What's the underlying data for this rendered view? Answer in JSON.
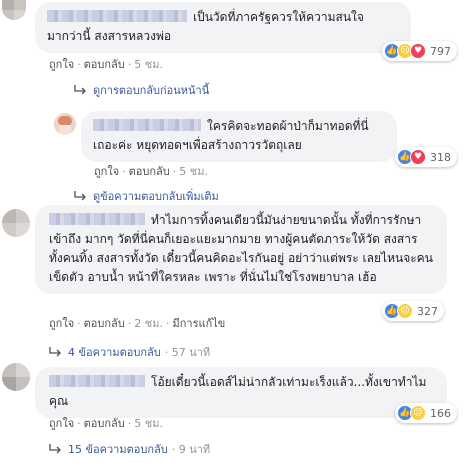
{
  "comments": [
    {
      "text": "เป็นวัดที่ภาครัฐควรให้ความสนใจมากว่านี้ สงสารหลวงพ่อ",
      "like": "ถูกใจ",
      "reply": "ตอบกลับ",
      "time": "5 ชม.",
      "reaction_count": "797"
    },
    {
      "text": "ใครคิดจะทอดผ้าป่าก็มาทอดที่นี่เถอะค่ะ หยุดทอดฯเพื่อสร้างถาวรวัตถุเลย",
      "like": "ถูกใจ",
      "reply": "ตอบกลับ",
      "time": "5 ชม.",
      "reaction_count": "318"
    },
    {
      "text": "ทำไมการทิ้งคนเดียวนี้มันง่ายขนาดนั้น ทั้งที่การรักษา เข้าถึง มากๆ วัดที่นี่คนก็เยอะแยะมากมาย ทางผู้คนตัดภาระให้วัด สงสารทั้งคนทิ้ง สงสารทั้งวัด เดี๋ยวนี้คนคิดอะไรกันอยู่ อย่าว่าแต่พระ เลยไหนจะคนเข็ดตัว อาบน้ำ หน้าที่ใครหละ เพราะ ที่นั่นไม่ใช่โรงพยาบาล เฮ้อ",
      "like": "ถูกใจ",
      "reply": "ตอบกลับ",
      "time": "2 ชม.",
      "edited": "มีการแก้ไข",
      "reaction_count": "327"
    },
    {
      "text": "โอ้ยเดี๋ยวนี้เอดส์ไม่น่ากลัวเท่ามะเร็งแล้ว...ทั้งเขาทำไมคุณ",
      "like": "ถูกใจ",
      "reply": "ตอบกลับ",
      "time": "5 ชม.",
      "reaction_count": "166"
    }
  ],
  "reply_links": {
    "prev": "ดูการตอบกลับก่อนหน้านี้",
    "more": "ดูข้อความตอบกลับเพิ่มเติม",
    "four": "4 ข้อความตอบกลับ",
    "four_time": "· 57 นาที",
    "fifteen": "15 ข้อความตอบกลับ",
    "fifteen_time": "· 9 นาที"
  },
  "colors": {
    "link": "#385898",
    "bubble": "#f2f3f5",
    "like": "#3b83f7",
    "love": "#f33e58",
    "sad": "#f7cf47"
  }
}
